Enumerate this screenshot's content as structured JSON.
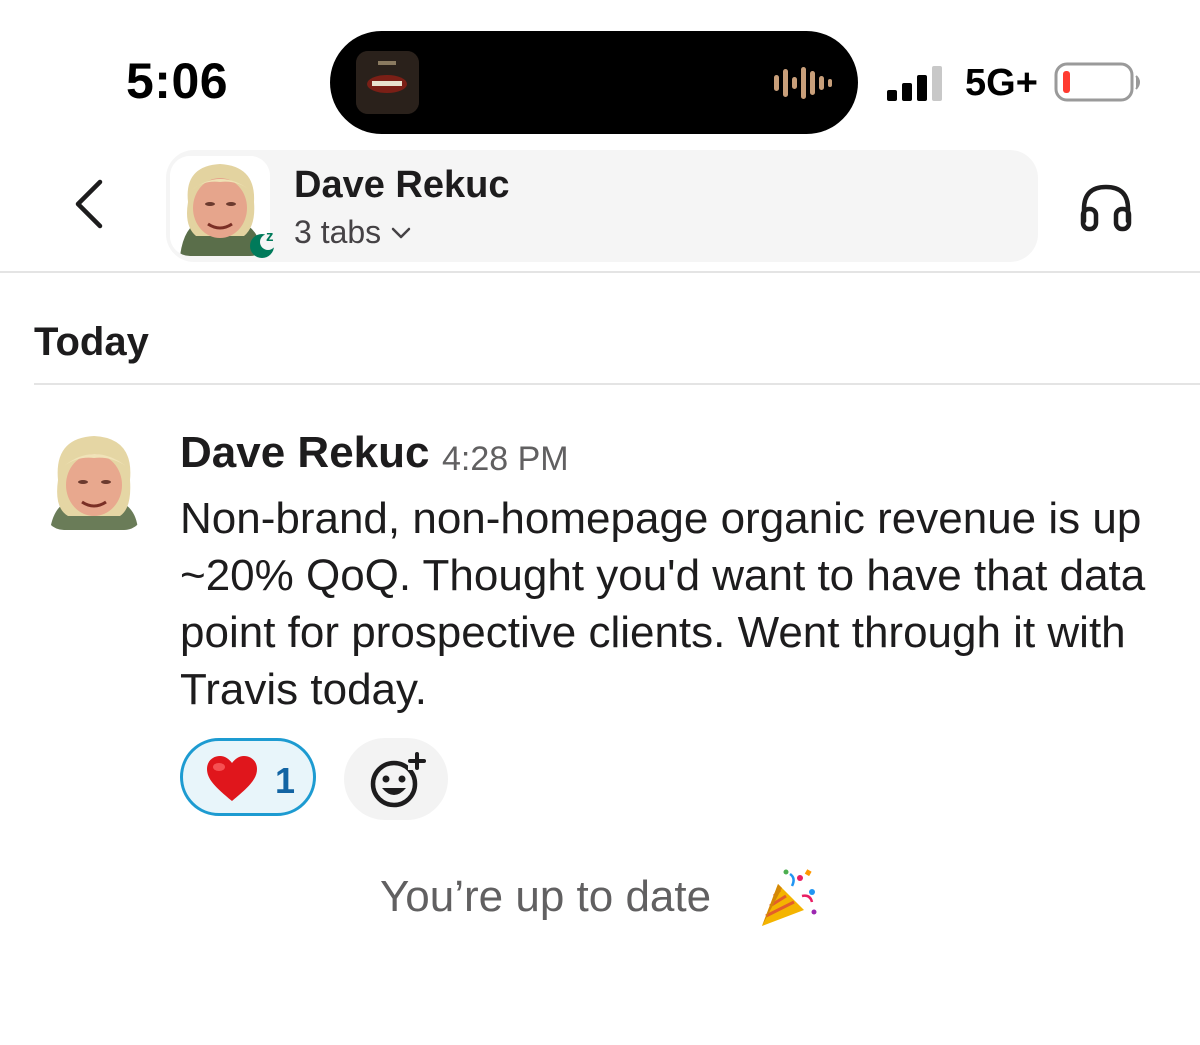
{
  "status_bar": {
    "time": "5:06",
    "network": "5G+",
    "battery_color": "#ff3b30"
  },
  "header": {
    "back_icon": "chevron-left-icon",
    "name": "Dave Rekuc",
    "subtitle": "3 tabs",
    "presence_icon": "snooze-icon",
    "huddle_icon": "headphones-icon"
  },
  "day_separator": "Today",
  "message": {
    "author": "Dave Rekuc",
    "time": "4:28 PM",
    "text": "Non-brand, non-homepage organic revenue is up ~20% QoQ. Thought you'd want to have that data point for prospective clients. Went through it with Travis today.",
    "reactions": [
      {
        "emoji": "heart-icon",
        "count": "1",
        "selected": true
      }
    ],
    "add_reaction_icon": "add-emoji-icon"
  },
  "footer": {
    "text": "You’re up to date",
    "icon": "party-popper-icon"
  },
  "colors": {
    "accent_blue": "#1264a3",
    "presence_green": "#007a5a"
  }
}
